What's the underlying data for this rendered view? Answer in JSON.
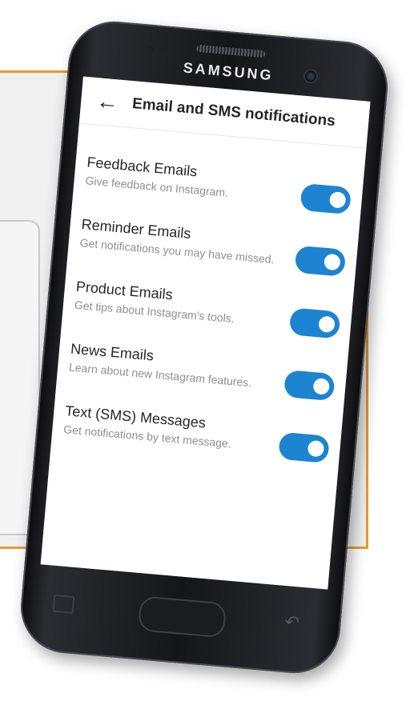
{
  "device": {
    "brand": "SAMSUNG"
  },
  "header": {
    "title": "Email and SMS notifications"
  },
  "settings": [
    {
      "title": "Feedback Emails",
      "subtitle": "Give feedback on Instagram.",
      "enabled": true
    },
    {
      "title": "Reminder Emails",
      "subtitle": "Get notifications you may have missed.",
      "enabled": true
    },
    {
      "title": "Product Emails",
      "subtitle": "Get tips about Instagram's tools.",
      "enabled": true
    },
    {
      "title": "News Emails",
      "subtitle": "Learn about new Instagram features.",
      "enabled": true
    },
    {
      "title": "Text (SMS) Messages",
      "subtitle": "Get notifications by text message.",
      "enabled": true
    }
  ],
  "colors": {
    "accent": "#1d84d1",
    "frame_border": "#e79a2d"
  },
  "icons": {
    "back": "back-arrow-icon"
  }
}
